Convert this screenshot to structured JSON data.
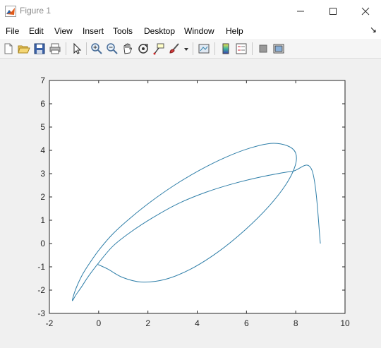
{
  "window": {
    "title": "Figure 1",
    "controls": [
      "minimize",
      "maximize",
      "close"
    ]
  },
  "menubar": {
    "items": [
      "File",
      "Edit",
      "View",
      "Insert",
      "Tools",
      "Desktop",
      "Window",
      "Help"
    ],
    "right_arrow": "↘"
  },
  "toolbar": {
    "icons": [
      "new-figure-icon",
      "open-file-icon",
      "save-icon",
      "print-icon",
      "pointer-icon",
      "zoom-in-icon",
      "zoom-out-icon",
      "pan-icon",
      "rotate-icon",
      "data-cursor-icon",
      "brush-icon",
      "brush-dropdown-icon",
      "link-plot-icon",
      "colorbar-icon",
      "legend-icon",
      "hide-tools-icon",
      "show-tools-icon"
    ]
  },
  "colors": {
    "line": "#2e7ea8",
    "accent": "#0072bd"
  },
  "chart_data": {
    "type": "line",
    "title": "",
    "xlabel": "",
    "ylabel": "",
    "xlim": [
      -2,
      10
    ],
    "ylim": [
      -3,
      7
    ],
    "xticks": [
      -2,
      0,
      2,
      4,
      6,
      8,
      10
    ],
    "yticks": [
      -3,
      -2,
      -1,
      0,
      1,
      2,
      3,
      4,
      5,
      6,
      7
    ],
    "grid": false,
    "series": [
      {
        "description": "spiral curve",
        "x": [
          9.0,
          8.66,
          7.86,
          6.78,
          5.57,
          4.35,
          3.2,
          2.18,
          1.31,
          0.59,
          0.02,
          -0.41,
          -0.72,
          -0.92,
          -1.03,
          -1.07,
          -1.05,
          -0.98,
          -0.85,
          -0.64,
          -0.34,
          0.07,
          0.61,
          1.29,
          2.12,
          3.07,
          4.1,
          5.15,
          6.15,
          7.01,
          7.65,
          7.99,
          7.98,
          7.61,
          6.91,
          5.96,
          4.86,
          3.73,
          2.66,
          1.72,
          0.96,
          0.38,
          -0.03
        ],
        "y": [
          0.0,
          3.14,
          3.1,
          2.9,
          2.6,
          2.2,
          1.7,
          1.1,
          0.5,
          -0.1,
          -0.8,
          -1.4,
          -1.9,
          -2.2,
          -2.4,
          -2.45,
          -2.35,
          -2.1,
          -1.75,
          -1.3,
          -0.8,
          -0.2,
          0.45,
          1.1,
          1.8,
          2.5,
          3.15,
          3.7,
          4.1,
          4.3,
          4.2,
          3.9,
          3.35,
          2.55,
          1.6,
          0.6,
          -0.35,
          -1.1,
          -1.55,
          -1.65,
          -1.45,
          -1.1,
          -0.9
        ]
      }
    ]
  }
}
